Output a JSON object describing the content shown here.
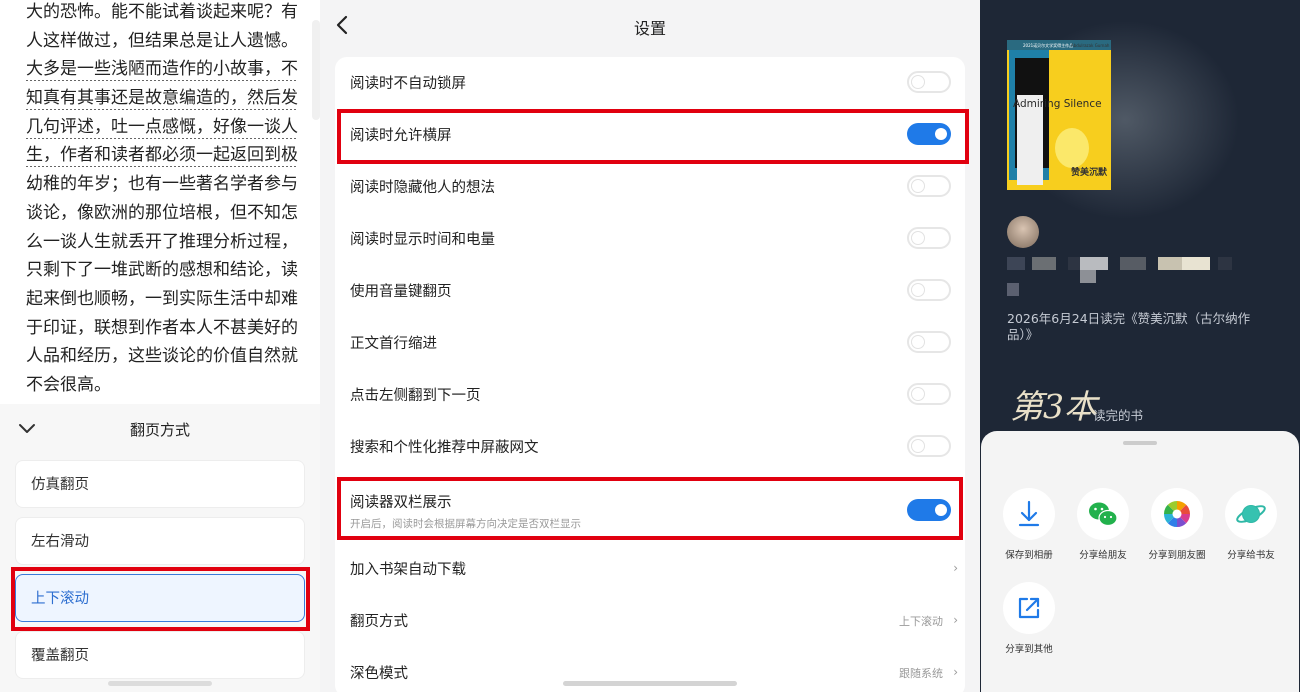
{
  "reader": {
    "lines": [
      "大的恐怖。能不能试着谈起来呢？有",
      "人这样做过，但结果总是让人遗憾。",
      "大多是一些浅陋而造作的小故事，不",
      "知真有其事还是故意编造的，然后发",
      "几句评述，吐一点感慨，好像一谈人",
      "生，作者和读者都必须一起返回到极",
      "幼稚的年岁；也有一些著名学者参与",
      "谈论，像欧洲的那位培根，但不知怎",
      "么一谈人生就丢开了推理分析过程，",
      "只剩下了一堆武断的感想和结论，读",
      "起来倒也顺畅，一到实际生活中却难",
      "于印证，联想到作者本人不甚美好的",
      "人品和经历，这些谈论的价值自然就",
      "不会很高。"
    ],
    "sheet": {
      "title": "翻页方式",
      "options": [
        "仿真翻页",
        "左右滑动",
        "上下滚动",
        "覆盖翻页"
      ],
      "selected": "上下滚动"
    }
  },
  "settings": {
    "title": "设置",
    "rows": [
      {
        "label": "阅读时不自动锁屏",
        "type": "toggle",
        "on": false
      },
      {
        "label": "阅读时允许横屏",
        "type": "toggle",
        "on": true
      },
      {
        "label": "阅读时隐藏他人的想法",
        "type": "toggle",
        "on": false
      },
      {
        "label": "阅读时显示时间和电量",
        "type": "toggle",
        "on": false
      },
      {
        "label": "使用音量键翻页",
        "type": "toggle",
        "on": false
      },
      {
        "label": "正文首行缩进",
        "type": "toggle",
        "on": false
      },
      {
        "label": "点击左侧翻到下一页",
        "type": "toggle",
        "on": false
      },
      {
        "label": "搜索和个性化推荐中屏蔽网文",
        "type": "toggle",
        "on": false
      },
      {
        "label": "阅读器双栏展示",
        "sub": "开启后，阅读时会根据屏幕方向决定是否双栏显示",
        "type": "toggle",
        "on": true
      },
      {
        "label": "加入书架自动下载",
        "type": "link",
        "value": ""
      },
      {
        "label": "翻页方式",
        "type": "link",
        "value": "上下滚动"
      },
      {
        "label": "深色模式",
        "type": "link",
        "value": "跟随系统"
      }
    ]
  },
  "share": {
    "book": {
      "title_en": "Admiring Silence",
      "title_cn": "赞美沉默",
      "series": "2021诺贝尔文学奖得主作品",
      "author_en": "Abdulrazak Gurnah"
    },
    "read_line": "2026年6月24日读完《赞美沉默（古尔纳作品）》",
    "rank_big": "第3本",
    "rank_small": "读完的书",
    "actions": [
      {
        "label": "保存到相册",
        "icon": "download-icon"
      },
      {
        "label": "分享给朋友",
        "icon": "wechat-icon"
      },
      {
        "label": "分享到朋友圈",
        "icon": "moments-icon"
      },
      {
        "label": "分享给书友",
        "icon": "planet-icon"
      },
      {
        "label": "分享到其他",
        "icon": "external-share-icon"
      }
    ],
    "colors": {
      "background": "#1e2736",
      "accent": "#1f7ae8",
      "highlight_box": "#e1000f"
    }
  }
}
